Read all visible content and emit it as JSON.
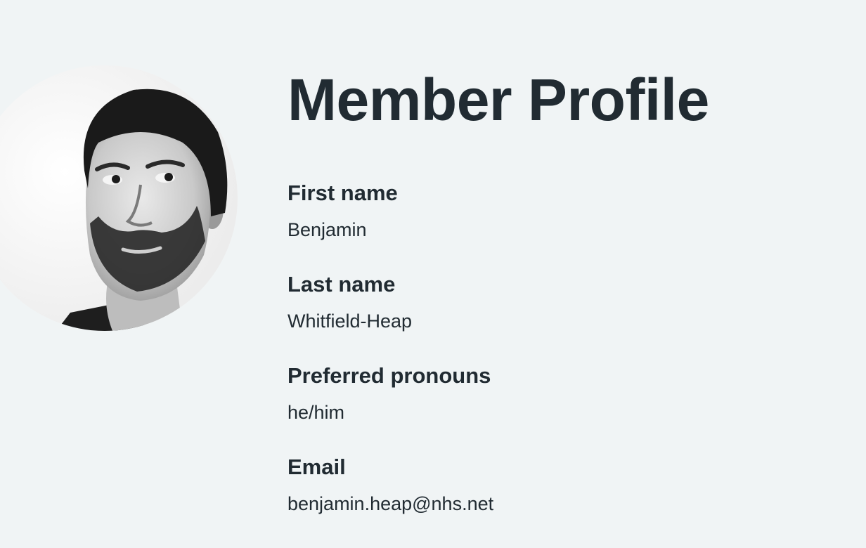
{
  "profile": {
    "title": "Member Profile",
    "avatar_alt": "Member photo",
    "fields": [
      {
        "label": "First name",
        "value": "Benjamin"
      },
      {
        "label": "Last name",
        "value": "Whitfield-Heap"
      },
      {
        "label": "Preferred pronouns",
        "value": "he/him"
      },
      {
        "label": "Email",
        "value": "benjamin.heap@nhs.net"
      }
    ]
  },
  "colors": {
    "background": "#f0f4f5",
    "text": "#212b32"
  }
}
